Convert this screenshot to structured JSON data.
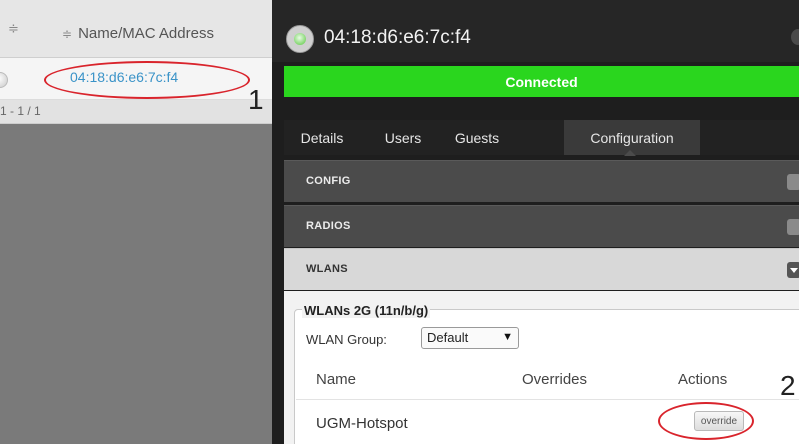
{
  "list": {
    "sort_glyph": "≑",
    "column_header": "Name/MAC Address",
    "rows": [
      {
        "mac": "04:18:d6:e6:7c:f4"
      }
    ],
    "pager": "1 - 1 / 1"
  },
  "annotations": {
    "label_1": "1",
    "label_2": "2",
    "circle_color": "#d9242c"
  },
  "detail": {
    "title": "04:18:d6:e6:7c:f4",
    "status": "Connected",
    "status_color": "#2ad61e",
    "tabs": [
      {
        "label": "Details"
      },
      {
        "label": "Users"
      },
      {
        "label": "Guests"
      },
      {
        "label": "Configuration",
        "active": true
      }
    ],
    "sections": {
      "config": "CONFIG",
      "radios": "RADIOS",
      "wlans": "WLANS"
    },
    "wlans": {
      "legend": "WLANs 2G (11n/b/g)",
      "group_label": "WLAN Group:",
      "group_value": "Default",
      "group_caret": "▼",
      "columns": [
        "Name",
        "Overrides",
        "Actions"
      ],
      "rows": [
        {
          "name": "UGM-Hotspot",
          "overrides": "",
          "action": "override"
        }
      ]
    }
  }
}
